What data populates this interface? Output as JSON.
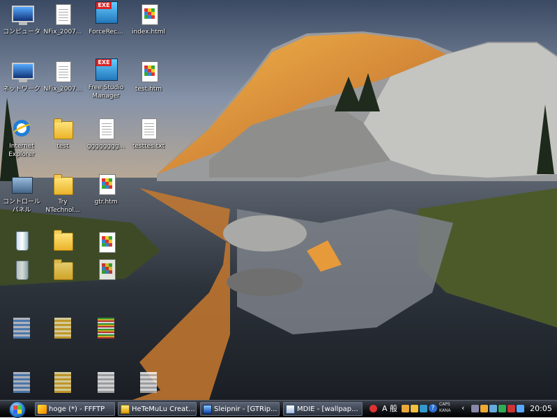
{
  "desktop": {
    "icons": [
      {
        "label": "コンピュータ"
      },
      {
        "label": "NFix_2007..."
      },
      {
        "label": "ForceRec..."
      },
      {
        "label": "index.html"
      },
      {
        "label": "ネットワーク"
      },
      {
        "label": "NFix_2007..."
      },
      {
        "label": "Free Studio Manager"
      },
      {
        "label": "test.htm"
      },
      {
        "label": "Internet Explorer"
      },
      {
        "label": "test"
      },
      {
        "label": "gggggggg..."
      },
      {
        "label": "testtes.txt"
      },
      {
        "label": "コントロール パネル"
      },
      {
        "label": "Try NTechnol..."
      },
      {
        "label": "gtr.htm"
      }
    ],
    "exe_badge": "EXE"
  },
  "taskbar": {
    "tasks": [
      {
        "label": "hoge (*) - FFFTP"
      },
      {
        "label": "HeTeMuLu Creat..."
      },
      {
        "label": "Sleipnir - [GTRip..."
      },
      {
        "label": "MDIE - [wallpap..."
      }
    ],
    "tray": {
      "ime_mode": "A",
      "ime_kanji": "般",
      "caps": "CAPS",
      "kana": "KANA",
      "help": "?"
    },
    "clock": "20:05"
  }
}
